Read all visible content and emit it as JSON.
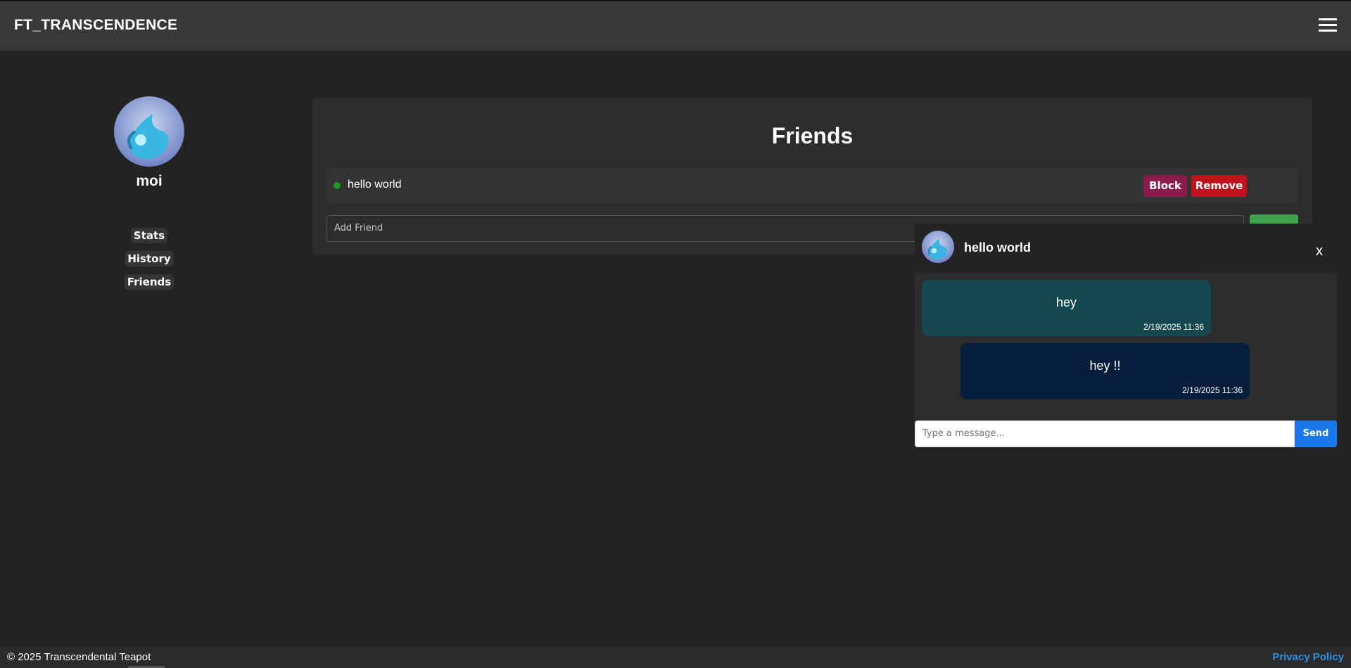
{
  "app": {
    "title": "FT_TRANSCENDENCE"
  },
  "header": {
    "menu_icon": "hamburger-menu-icon"
  },
  "profile": {
    "username": "moi",
    "nav": [
      {
        "label": "Stats"
      },
      {
        "label": "History"
      },
      {
        "label": "Friends"
      }
    ]
  },
  "friends": {
    "title": "Friends",
    "list": [
      {
        "name": "hello world",
        "status": "online",
        "status_color": "#1f9a1f",
        "block_label": "Block",
        "remove_label": "Remove"
      }
    ],
    "add_placeholder": "Add Friend"
  },
  "chat": {
    "name": "hello world",
    "close_label": "x",
    "messages": [
      {
        "text": "hey",
        "time": "2/19/2025 11:36",
        "color": "#15474f"
      },
      {
        "text": "hey !!",
        "time": "2/19/2025 11:36",
        "color": "#061d3c"
      }
    ],
    "input_placeholder": "Type a message...",
    "send_label": "Send"
  },
  "footer": {
    "copyright": "© 2025 Transcendental Teapot",
    "privacy": "Privacy Policy"
  },
  "colors": {
    "accent": "#1a78e8",
    "link": "#2f8fe0",
    "block": "#8c1c4a",
    "remove": "#c1121c",
    "add": "#3fa14a"
  }
}
